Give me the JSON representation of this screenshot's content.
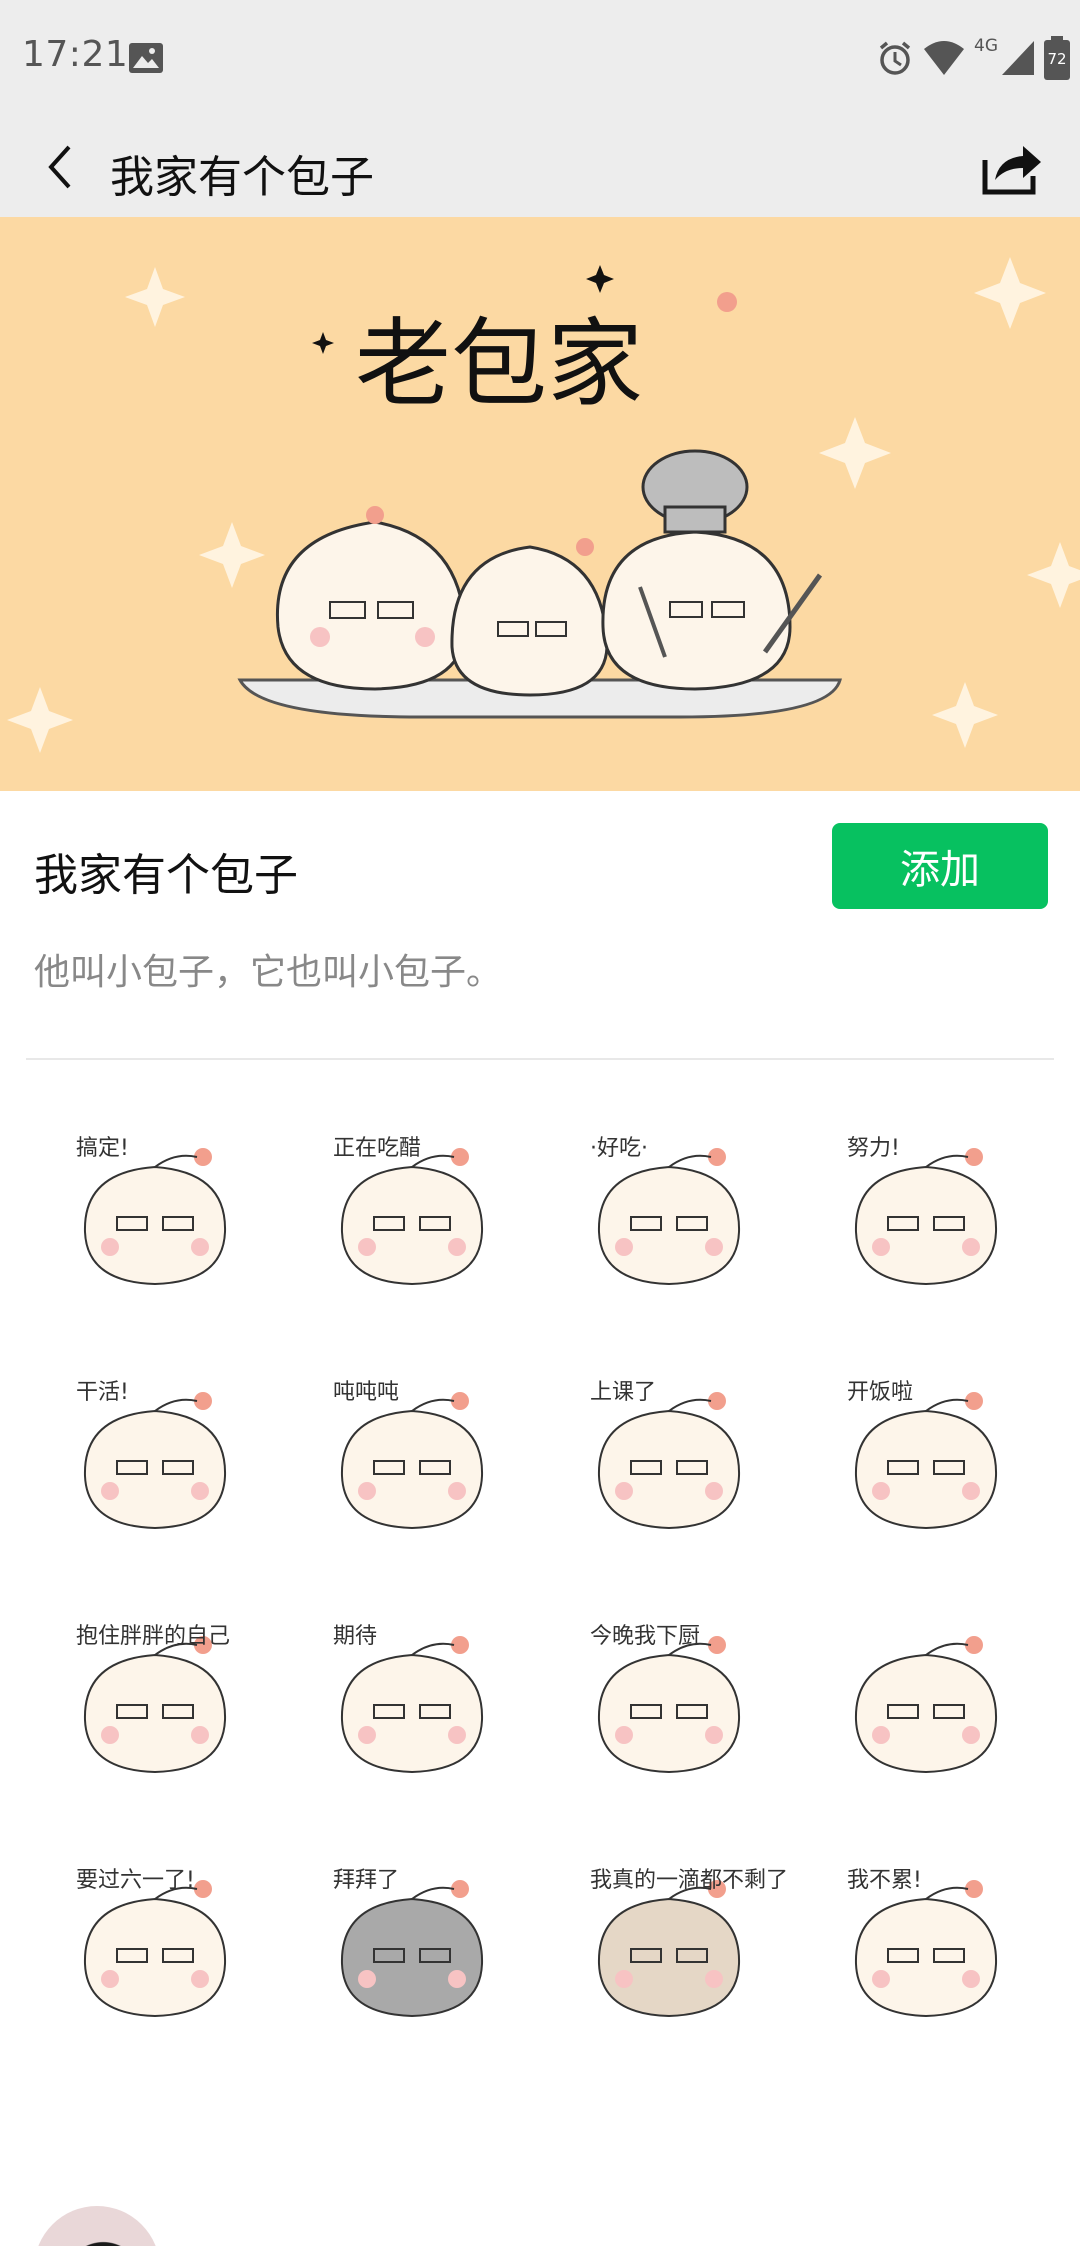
{
  "status_bar": {
    "time": "17:21",
    "network": "4G",
    "battery": "72",
    "icons": [
      "image-icon",
      "alarm-icon",
      "wifi-icon",
      "signal-icon",
      "battery-icon"
    ]
  },
  "nav": {
    "title": "我家有个包子",
    "back_icon": "chevron-left-icon",
    "share_icon": "share-icon"
  },
  "banner": {
    "title": "老包家",
    "background_color": "#fcd9a3"
  },
  "pack": {
    "name": "我家有个包子",
    "add_label": "添加",
    "description": "他叫小包子，它也叫小包子。",
    "accent_color": "#07c160"
  },
  "stickers": [
    {
      "caption": "搞定!"
    },
    {
      "caption": "正在吃醋"
    },
    {
      "caption": "·好吃·"
    },
    {
      "caption": "努力!"
    },
    {
      "caption": "干活!"
    },
    {
      "caption": "吨吨吨"
    },
    {
      "caption": "上课了"
    },
    {
      "caption": "开饭啦"
    },
    {
      "caption": "抱住胖胖的自己"
    },
    {
      "caption": "期待"
    },
    {
      "caption": "今晚我下厨"
    },
    {
      "caption": ""
    },
    {
      "caption": "要过六一了!"
    },
    {
      "caption": "拜拜了"
    },
    {
      "caption": "我真的一滴都不剩了"
    },
    {
      "caption": "我不累!"
    }
  ]
}
